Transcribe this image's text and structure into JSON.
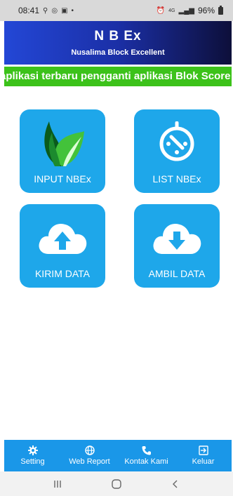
{
  "status": {
    "time": "08:41",
    "battery": "96%",
    "network": "4G"
  },
  "header": {
    "title": "N B Ex",
    "subtitle": "Nusalima Block Excellent"
  },
  "marquee": "aplikasi terbaru pengganti aplikasi Blok Score",
  "tiles": [
    {
      "label": "INPUT NBEx",
      "icon": "leaf-icon"
    },
    {
      "label": "LIST NBEx",
      "icon": "list-timer-icon"
    },
    {
      "label": "KIRIM DATA",
      "icon": "cloud-upload-icon"
    },
    {
      "label": "AMBIL DATA",
      "icon": "cloud-download-icon"
    }
  ],
  "nav": [
    {
      "label": "Setting",
      "icon": "gear-icon"
    },
    {
      "label": "Web Report",
      "icon": "globe-icon"
    },
    {
      "label": "Kontak Kami",
      "icon": "phone-icon"
    },
    {
      "label": "Keluar",
      "icon": "logout-icon"
    }
  ],
  "colors": {
    "tile": "#1ea7ea",
    "marquee": "#3cc21a",
    "nav": "#1a97e8"
  }
}
